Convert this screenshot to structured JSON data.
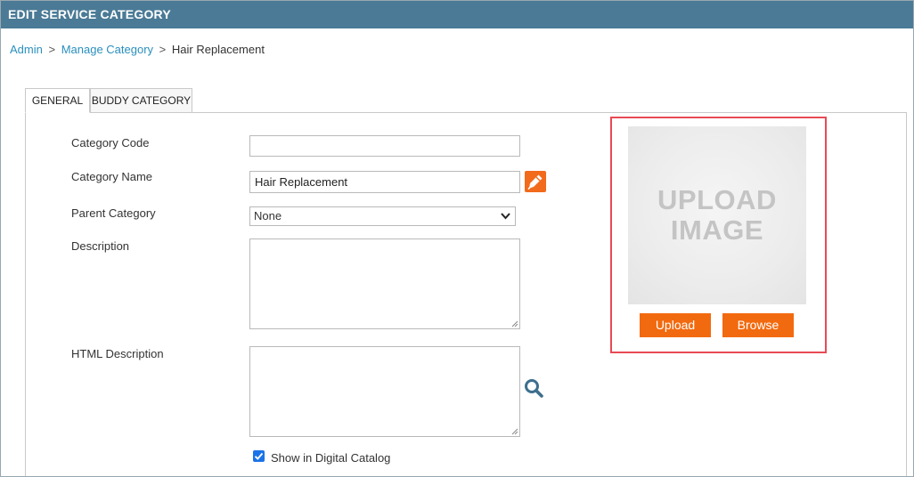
{
  "header": {
    "title": "EDIT SERVICE CATEGORY"
  },
  "breadcrumb": {
    "items": [
      "Admin",
      "Manage Category"
    ],
    "separator": ">",
    "current": "Hair Replacement"
  },
  "tabs": {
    "general": "GENERAL",
    "buddy": "BUDDY CATEGORY"
  },
  "form": {
    "category_code": {
      "label": "Category Code",
      "value": ""
    },
    "category_name": {
      "label": "Category Name",
      "value": "Hair Replacement"
    },
    "parent_category": {
      "label": "Parent Category",
      "value": "None"
    },
    "description": {
      "label": "Description",
      "value": ""
    },
    "html_description": {
      "label": "HTML Description",
      "value": ""
    },
    "show_in_catalog": {
      "label": "Show in Digital Catalog",
      "checked": true
    }
  },
  "upload": {
    "placeholder_text": "UPLOAD\nIMAGE",
    "upload_label": "Upload",
    "browse_label": "Browse"
  },
  "colors": {
    "header_bg": "#4a7a96",
    "link": "#2a8fbd",
    "accent_orange": "#f26a0f",
    "highlight_border": "#e84a55",
    "checkbox": "#1a73e8"
  },
  "icons": [
    "pen-edit-icon",
    "search-icon",
    "chevron-down-icon",
    "check-icon"
  ]
}
